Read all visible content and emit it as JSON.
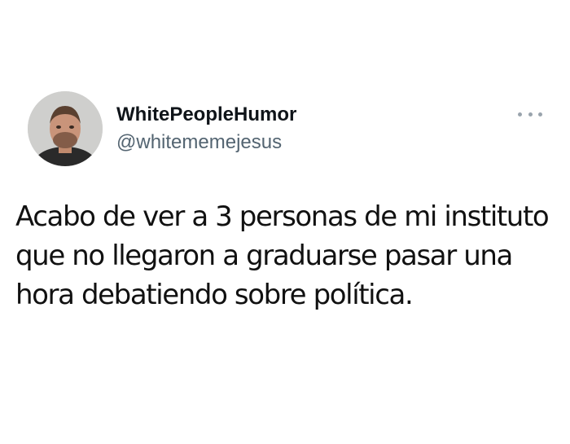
{
  "tweet": {
    "author": {
      "display_name": "WhitePeopleHumor",
      "handle": "@whitememejesus",
      "avatar_icon": "profile-photo"
    },
    "more_icon": "more-options-icon",
    "text": "Acabo de ver a 3 personas de mi instituto\nque no llegaron a graduarse pasar una\nhora debatiendo sobre política.",
    "colors": {
      "text": "#0f1419",
      "secondary": "#536471",
      "more_dots": "#9aa4ad",
      "background": "#ffffff"
    }
  }
}
